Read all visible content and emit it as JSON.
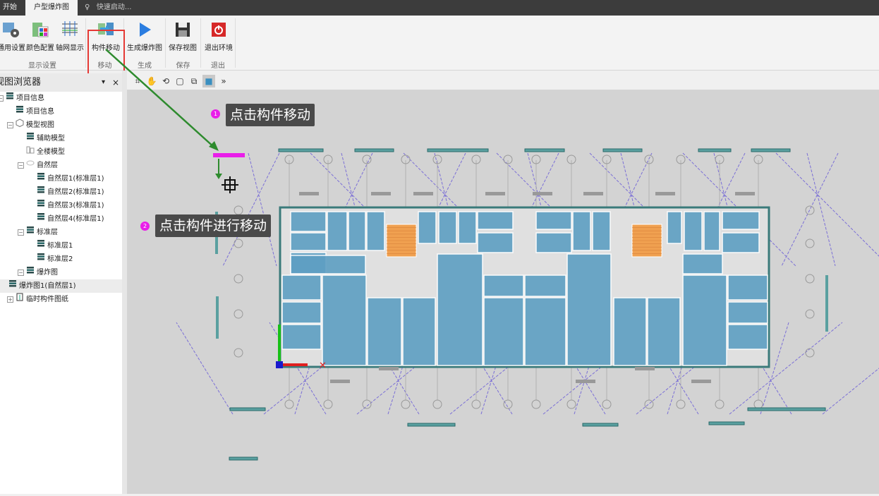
{
  "tabs": [
    {
      "label": "开始"
    },
    {
      "label": "户型爆炸图"
    }
  ],
  "quick_launch": "快速启动...",
  "ribbon": {
    "buttons": [
      {
        "label": "通用设置"
      },
      {
        "label": "颜色配置"
      },
      {
        "label": "轴网显示"
      },
      {
        "label": "构件移动"
      },
      {
        "label": "生成爆炸图"
      },
      {
        "label": "保存视图"
      },
      {
        "label": "退出环境"
      }
    ],
    "groups": [
      {
        "label": "显示设置"
      },
      {
        "label": "移动"
      },
      {
        "label": "生成"
      },
      {
        "label": "保存"
      },
      {
        "label": "退出"
      }
    ]
  },
  "panel": {
    "title": "视图浏览器",
    "pin": "▾",
    "close": "×"
  },
  "tree": [
    {
      "label": "项目信息"
    },
    {
      "label": "项目信息"
    },
    {
      "label": "模型视图"
    },
    {
      "label": "辅助模型"
    },
    {
      "label": "全楼模型"
    },
    {
      "label": "自然层"
    },
    {
      "label": "自然层1(标准层1)"
    },
    {
      "label": "自然层2(标准层1)"
    },
    {
      "label": "自然层3(标准层1)"
    },
    {
      "label": "自然层4(标准层1)"
    },
    {
      "label": "标准层"
    },
    {
      "label": "标准层1"
    },
    {
      "label": "标准层2"
    },
    {
      "label": "爆炸图"
    },
    {
      "label": "爆炸图1(自然层1)"
    },
    {
      "label": "临时构件图纸"
    }
  ],
  "callouts": [
    {
      "num": "1",
      "text": "点击构件移动"
    },
    {
      "num": "2",
      "text": "点击构件进行移动"
    }
  ],
  "colors": {
    "accent": "#e53935",
    "room": "#5e9fc3",
    "stair": "#f0a050",
    "magenta": "#e91ee9",
    "arrow": "#2e8b2e"
  }
}
